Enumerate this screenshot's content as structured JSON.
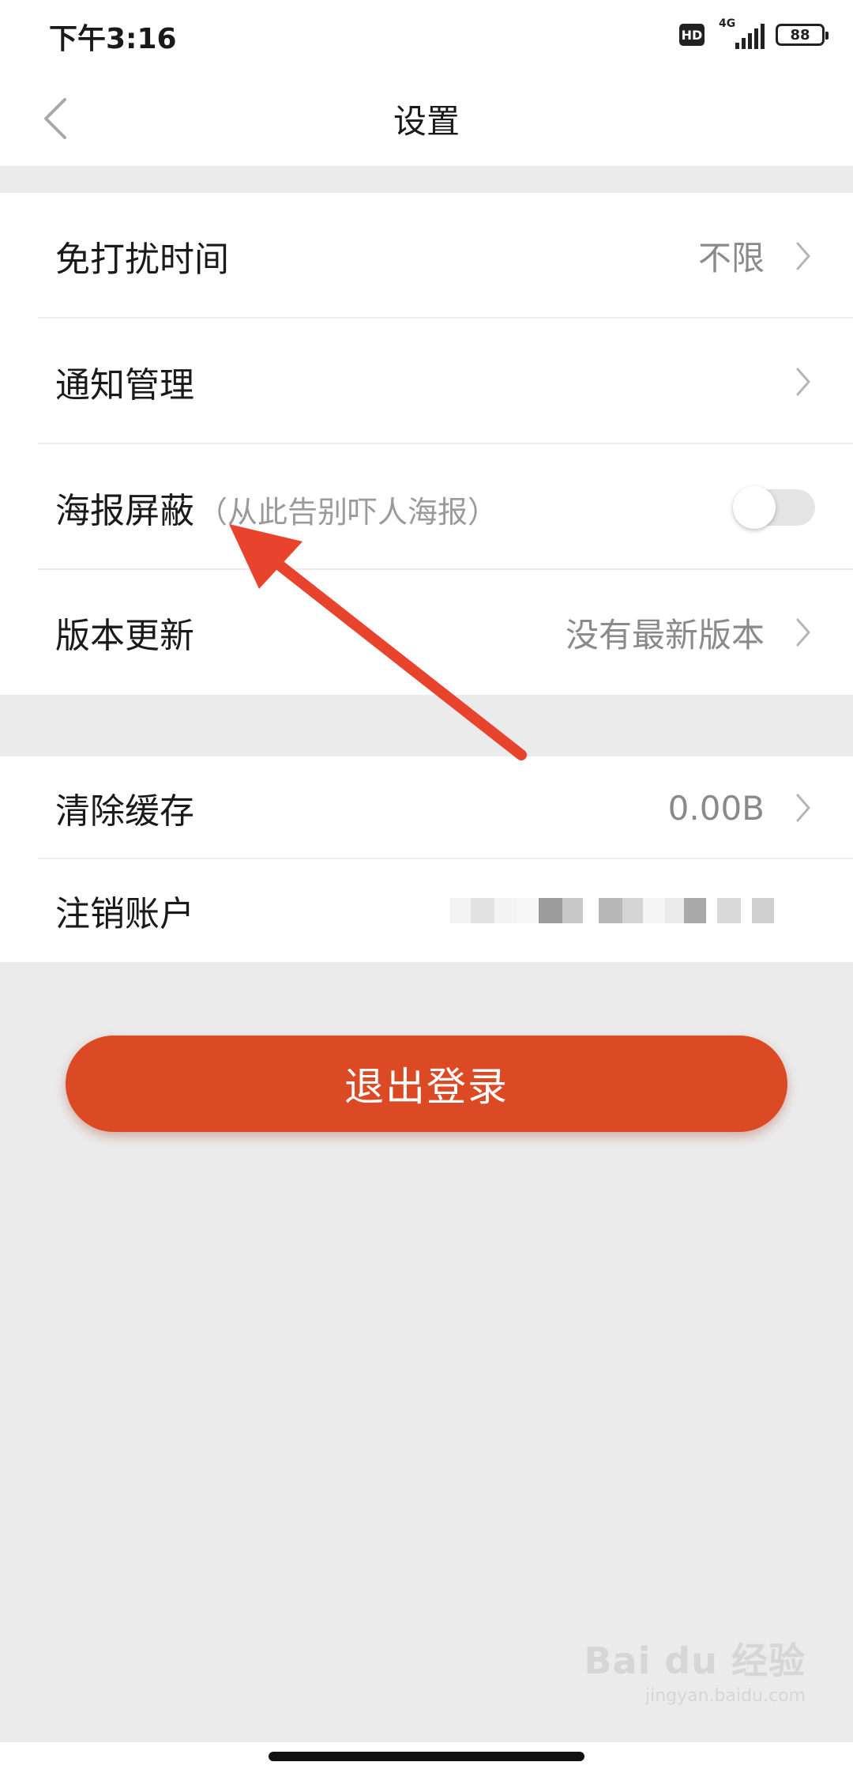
{
  "status_bar": {
    "time": "下午3:16",
    "hd_label": "HD",
    "network_label": "4G",
    "battery_level": "88"
  },
  "header": {
    "title": "设置"
  },
  "settings_group_1": [
    {
      "label": "免打扰时间",
      "value": "不限"
    },
    {
      "label": "通知管理",
      "value": ""
    },
    {
      "label": "海报屏蔽",
      "hint": "（从此告别吓人海报）",
      "toggle_on": false
    },
    {
      "label": "版本更新",
      "value": "没有最新版本"
    }
  ],
  "settings_group_2": [
    {
      "label": "清除缓存",
      "value": "0.00B"
    },
    {
      "label": "注销账户"
    }
  ],
  "logout_button": {
    "label": "退出登录",
    "color": "#db4a24"
  },
  "annotation_arrow": {
    "color": "#e8432c"
  },
  "watermark": {
    "main": "Bai du 经验",
    "sub": "jingyan.baidu.com"
  }
}
